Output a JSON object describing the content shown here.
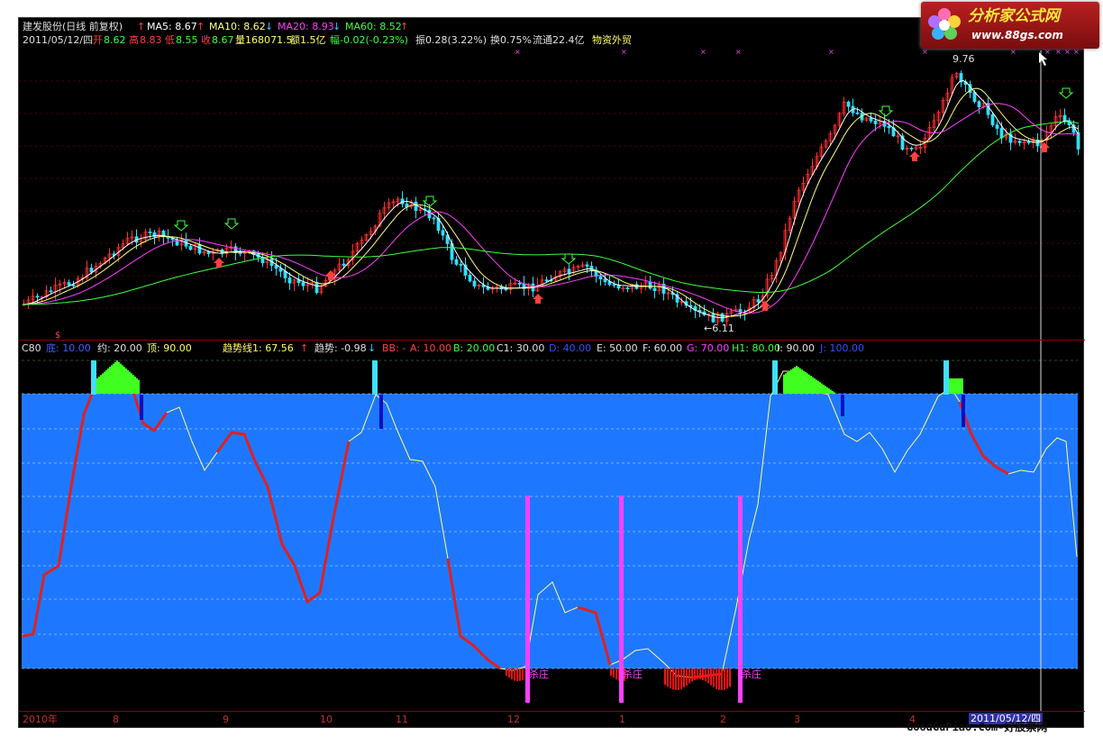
{
  "header": {
    "stock": "建发股份(日线 前复权)",
    "ma5": "MA5: 8.67",
    "ma10": "MA10: 8.62",
    "ma20": "MA20: 8.93",
    "ma60": "MA60: 8.52",
    "date": "2011/05/12/四",
    "open_lbl": "开",
    "open_val": "8.62",
    "high_lbl": "高",
    "high_val": "8.83",
    "low_lbl": "低",
    "low_val": "8.55",
    "close_lbl": "收",
    "close_val": "8.67",
    "vol": "量168071.5",
    "amount": "额1.5亿",
    "change": "幅-0.02(-0.23%)",
    "amp": "振0.28(3.22%)",
    "turnover": "换0.75%",
    "float": "流通22.4亿",
    "industry": "物资外贸"
  },
  "price_panel": {
    "high_label": "9.76",
    "low_label": "←6.11",
    "dollar_mark": "$"
  },
  "indicator_bar": {
    "name": "C80",
    "bottom": "底: 10.00",
    "about": "约: 20.00",
    "top": "顶: 90.00",
    "trend1": "趋势线1: 67.56",
    "trend": "趋势: -0.98",
    "bb": "BB: -",
    "a": "A: 10.00",
    "b": "B: 20.00",
    "c1": "C1: 30.00",
    "d": "D: 40.00",
    "e": "E: 50.00",
    "f": "F: 60.00",
    "g": "G: 70.00",
    "h1": "H1: 80.00",
    "i": "I: 90.00",
    "j": "J: 100.00"
  },
  "signals": {
    "kill_label": "杀庄"
  },
  "date_axis": {
    "labels": [
      "2010年",
      "8",
      "9",
      "10",
      "11",
      "12",
      "1",
      "2",
      "3",
      "4"
    ],
    "cursor_date": "2011/05/12/四"
  },
  "watermarks": {
    "logo_text": "分析家公式网",
    "logo_url": "www.88gs.com",
    "footer": "GoodGuPiao.Com-好股票网"
  },
  "colors": {
    "background": "#000000",
    "up": "#ff3030",
    "down": "#30e0ff",
    "ma5": "#ffffff",
    "ma10": "#ffff80",
    "ma20": "#ff40ff",
    "ma60": "#40ff40",
    "band": "#1e78ff",
    "kill": "#ff40ff"
  }
}
